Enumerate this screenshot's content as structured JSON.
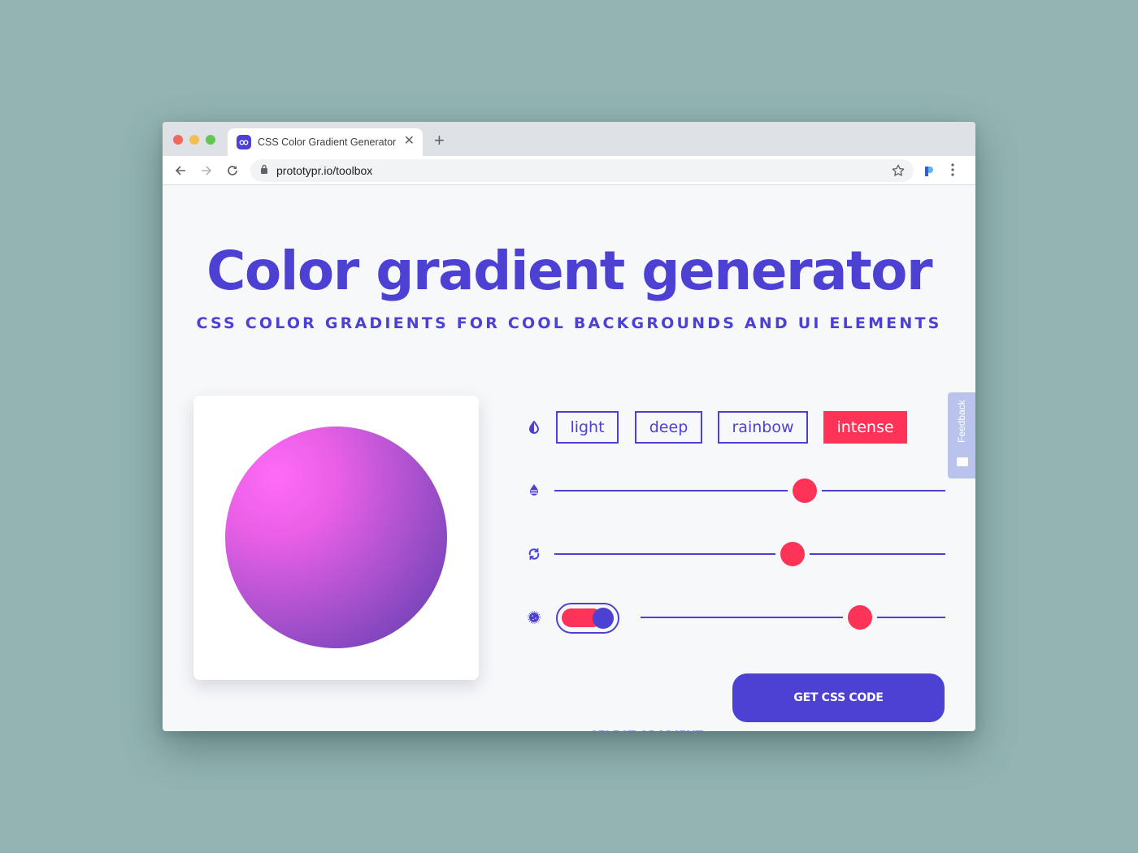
{
  "browser": {
    "tab_title": "CSS Color Gradient Generator",
    "new_tab_symbol": "+",
    "close_symbol": "✕",
    "url": "prototypr.io/toolbox",
    "icons": [
      "back-arrow-icon",
      "forward-arrow-icon",
      "reload-icon",
      "lock-icon",
      "star-icon",
      "prototypr-extension-icon",
      "more-vert-icon"
    ]
  },
  "page": {
    "title": "Color gradient generator",
    "subtitle": "CSS COLOR GRADIENTS FOR COOL BACKGROUNDS AND UI ELEMENTS"
  },
  "preview": {
    "gradient_colors": [
      "#ff6bf8",
      "#b554d3",
      "#5e37a8"
    ]
  },
  "controls": {
    "style_chips": [
      {
        "label": "light",
        "active": false
      },
      {
        "label": "deep",
        "active": false
      },
      {
        "label": "rainbow",
        "active": false
      },
      {
        "label": "intense",
        "active": true
      }
    ],
    "sliders": [
      {
        "name": "saturation",
        "icon": "drop-half-icon",
        "value_percent": 64
      },
      {
        "name": "rotation",
        "icon": "rotate-icon",
        "value_percent": 61
      },
      {
        "name": "noise",
        "icon": "noise-icon",
        "value_percent": 72
      }
    ],
    "noise_toggle_on": true
  },
  "actions": {
    "select_label": "SELECT GRADIENT",
    "css_label": "GET CSS CODE"
  },
  "feedback": {
    "label": "Feedback"
  },
  "colors": {
    "primary": "#4d41d3",
    "accent": "#ff3257",
    "background": "#f7f8fa",
    "desktop": "#93b4b2"
  }
}
